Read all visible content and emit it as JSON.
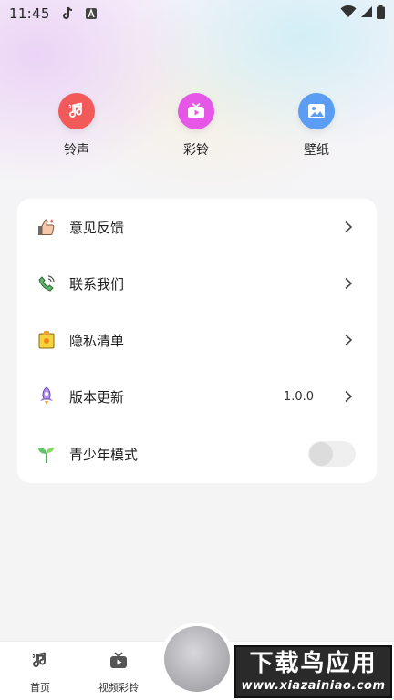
{
  "status_bar": {
    "time": "11:45",
    "icons": [
      "tiktok-icon",
      "a-badge-icon",
      "wifi-icon",
      "signal-icon",
      "battery-icon"
    ]
  },
  "quick_actions": [
    {
      "label": "铃声",
      "icon": "music-note-icon",
      "color": "#f25a5a"
    },
    {
      "label": "彩铃",
      "icon": "video-play-icon",
      "color": "#e657e8"
    },
    {
      "label": "壁纸",
      "icon": "picture-icon",
      "color": "#5a9df2"
    }
  ],
  "menu": {
    "feedback": {
      "label": "意见反馈",
      "icon": "thumbs-up-icon"
    },
    "contact": {
      "label": "联系我们",
      "icon": "phone-icon"
    },
    "privacy": {
      "label": "隐私清单",
      "icon": "privacy-list-icon"
    },
    "version": {
      "label": "版本更新",
      "icon": "rocket-icon",
      "value": "1.0.0"
    },
    "youth": {
      "label": "青少年模式",
      "icon": "sprout-icon",
      "enabled": false
    }
  },
  "bottom_nav": {
    "home": {
      "label": "首页",
      "icon": "music-note-icon"
    },
    "video": {
      "label": "视频彩铃",
      "icon": "tv-play-icon"
    }
  },
  "watermark": {
    "title": "下载鸟应用",
    "url": "www.xiazainiao.com"
  }
}
